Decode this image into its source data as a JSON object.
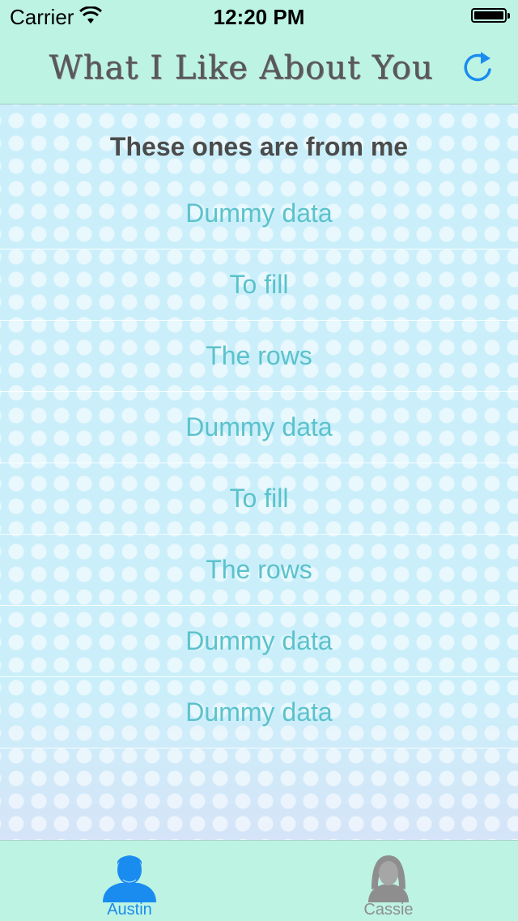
{
  "status_bar": {
    "carrier": "Carrier",
    "time": "12:20 PM",
    "wifi_icon": "wifi-icon",
    "battery_icon": "battery-icon"
  },
  "nav": {
    "title": "What I Like About You",
    "refresh_icon": "refresh-icon",
    "accent_color": "#1a8cf0"
  },
  "section": {
    "header": "These ones are from me"
  },
  "rows": [
    "Dummy data",
    "To fill",
    "The rows",
    "Dummy data",
    "To fill",
    "The rows",
    "Dummy data",
    "Dummy data"
  ],
  "tabs": [
    {
      "label": "Austin",
      "icon": "male-user-icon",
      "selected": true
    },
    {
      "label": "Cassie",
      "icon": "female-user-icon",
      "selected": false
    }
  ],
  "colors": {
    "bar_background": "#bdf3e3",
    "row_text": "#5bc2cb",
    "header_text": "#4b4b4b"
  }
}
